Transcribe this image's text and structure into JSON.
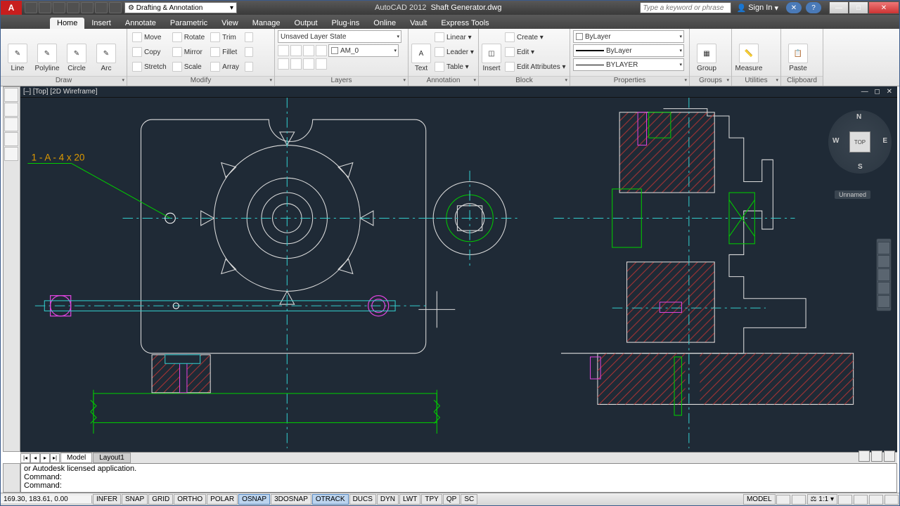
{
  "app": {
    "name": "AutoCAD 2012",
    "file": "Shaft Generator.dwg",
    "workspace": "Drafting & Annotation"
  },
  "search": {
    "placeholder": "Type a keyword or phrase"
  },
  "signin": "Sign In",
  "tabs": [
    "Home",
    "Insert",
    "Annotate",
    "Parametric",
    "View",
    "Manage",
    "Output",
    "Plug-ins",
    "Online",
    "Vault",
    "Express Tools"
  ],
  "active_tab": "Home",
  "ribbon": {
    "draw": {
      "title": "Draw",
      "btns": [
        "Line",
        "Polyline",
        "Circle",
        "Arc"
      ]
    },
    "modify": {
      "title": "Modify",
      "r1": [
        "Move",
        "Rotate",
        "Trim"
      ],
      "r2": [
        "Copy",
        "Mirror",
        "Fillet"
      ],
      "r3": [
        "Stretch",
        "Scale",
        "Array"
      ]
    },
    "layers": {
      "title": "Layers",
      "state": "Unsaved Layer State",
      "current": "AM_0"
    },
    "annotation": {
      "title": "Annotation",
      "text": "Text",
      "items": [
        "Linear",
        "Leader",
        "Table"
      ]
    },
    "block": {
      "title": "Block",
      "insert": "Insert",
      "items": [
        "Create",
        "Edit",
        "Edit Attributes"
      ]
    },
    "properties": {
      "title": "Properties",
      "color": "ByLayer",
      "lw": "ByLayer",
      "lt": "BYLAYER"
    },
    "groups": {
      "title": "Groups",
      "btn": "Group"
    },
    "utilities": {
      "title": "Utilities",
      "btn": "Measure"
    },
    "clipboard": {
      "title": "Clipboard",
      "btn": "Paste"
    }
  },
  "viewport": {
    "label": "[–] [Top] [2D Wireframe]"
  },
  "annotation_text": "1 - A - 4 x 20",
  "viewcube": {
    "face": "TOP",
    "n": "N",
    "s": "S",
    "e": "E",
    "w": "W",
    "wcs": "Unnamed"
  },
  "model_tabs": [
    "Model",
    "Layout1"
  ],
  "active_model_tab": "Model",
  "command": {
    "l1": "or Autodesk licensed application.",
    "l2": "Command:",
    "l3": "Command:"
  },
  "status": {
    "coords": "169.30, 183.61, 0.00",
    "toggles": [
      "INFER",
      "SNAP",
      "GRID",
      "ORTHO",
      "POLAR",
      "OSNAP",
      "3DOSNAP",
      "OTRACK",
      "DUCS",
      "DYN",
      "LWT",
      "TPY",
      "QP",
      "SC"
    ],
    "on": [
      "OSNAP",
      "OTRACK"
    ],
    "model": "MODEL",
    "scale": "1:1"
  }
}
